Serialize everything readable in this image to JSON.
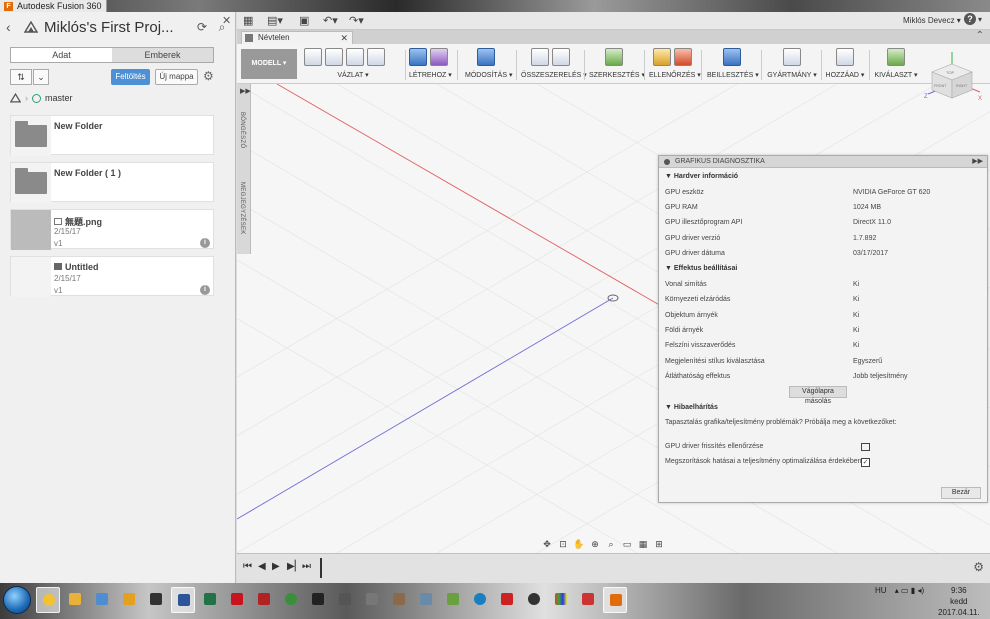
{
  "window": {
    "title": "Autodesk Fusion 360"
  },
  "data_panel": {
    "project_title": "Miklós's First Proj...",
    "tabs": [
      "Adat",
      "Emberek"
    ],
    "upload_label": "Feltöltés",
    "new_folder_label": "Új mappa",
    "branch": "master",
    "items": [
      {
        "name": "New Folder",
        "date": "",
        "version": "",
        "type": "folder"
      },
      {
        "name": "New Folder ( 1 )",
        "date": "",
        "version": "",
        "type": "folder"
      },
      {
        "name": "無題.png",
        "date": "2/15/17",
        "version": "v1",
        "type": "image"
      },
      {
        "name": "Untitled",
        "date": "2/15/17",
        "version": "v1",
        "type": "design"
      }
    ]
  },
  "topbar": {
    "user": "Miklós Devecz ▾",
    "help": "?"
  },
  "document_tab": {
    "title": "Névtelen"
  },
  "ribbon": {
    "workspace": "MODELL ▾",
    "groups": [
      {
        "label": "VÁZLAT ▾"
      },
      {
        "label": "LÉTREHOZ ▾"
      },
      {
        "label": "MÓDOSÍTÁS ▾"
      },
      {
        "label": "ÖSSZESZERELÉS ▾"
      },
      {
        "label": "SZERKESZTÉS ▾"
      },
      {
        "label": "ELLENŐRZÉS ▾"
      },
      {
        "label": "BEILLESZTÉS ▾"
      },
      {
        "label": "GYÁRTMÁNY ▾"
      },
      {
        "label": "HOZZÁAD ▾"
      },
      {
        "label": "KIVÁLASZT ▾"
      }
    ]
  },
  "viewcube": {
    "face_top": "TOP",
    "face_front": "FRONT",
    "face_right": "RIGHT",
    "axis_z": "Z",
    "axis_x": "X"
  },
  "side_strip": {
    "browser": "BÖNGÉSZŐ",
    "comments": "MEGJEGYZÉSEK"
  },
  "diagnostics": {
    "title": "GRAFIKUS DIAGNOSZTIKA",
    "hardware_section": "Hardver információ",
    "hardware": [
      {
        "key": "GPU eszköz",
        "value": "NVIDIA GeForce GT 620"
      },
      {
        "key": "GPU RAM",
        "value": "1024 MB"
      },
      {
        "key": "GPU illesztőprogram API",
        "value": "DirectX 11.0"
      },
      {
        "key": "GPU driver verzió",
        "value": "1.7.892"
      },
      {
        "key": "GPU driver dátuma",
        "value": "03/17/2017"
      }
    ],
    "effects_section": "Effektus beállításai",
    "effects": [
      {
        "key": "Vonal simítás",
        "value": "Ki"
      },
      {
        "key": "Környezeti elzáródás",
        "value": "Ki"
      },
      {
        "key": "Objektum árnyék",
        "value": "Ki"
      },
      {
        "key": "Földi árnyék",
        "value": "Ki"
      },
      {
        "key": "Felszíni visszaverődés",
        "value": "Ki"
      },
      {
        "key": "Megjelenítési stílus kiválasztása",
        "value": "Egyszerű"
      },
      {
        "key": "Átláthatóság effektus",
        "value": "Jobb teljesítmény"
      }
    ],
    "copy_button": "Vágólapra másolás",
    "troubleshoot_section": "Hibaelhárítás",
    "troubleshoot_tip": "Tapasztalás grafika/teljesítmény problémák? Próbálja meg a következőket:",
    "troubleshoot_items": [
      {
        "key": "GPU driver frissítés ellenőrzése"
      },
      {
        "key": "Megszorítások  hatásai a teljesítmény optimalizálása érdekében"
      }
    ],
    "close_button": "Bezár"
  },
  "taskbar": {
    "tray_lang": "HU",
    "time": "9:36",
    "day": "kedd",
    "date": "2017.04.11."
  }
}
